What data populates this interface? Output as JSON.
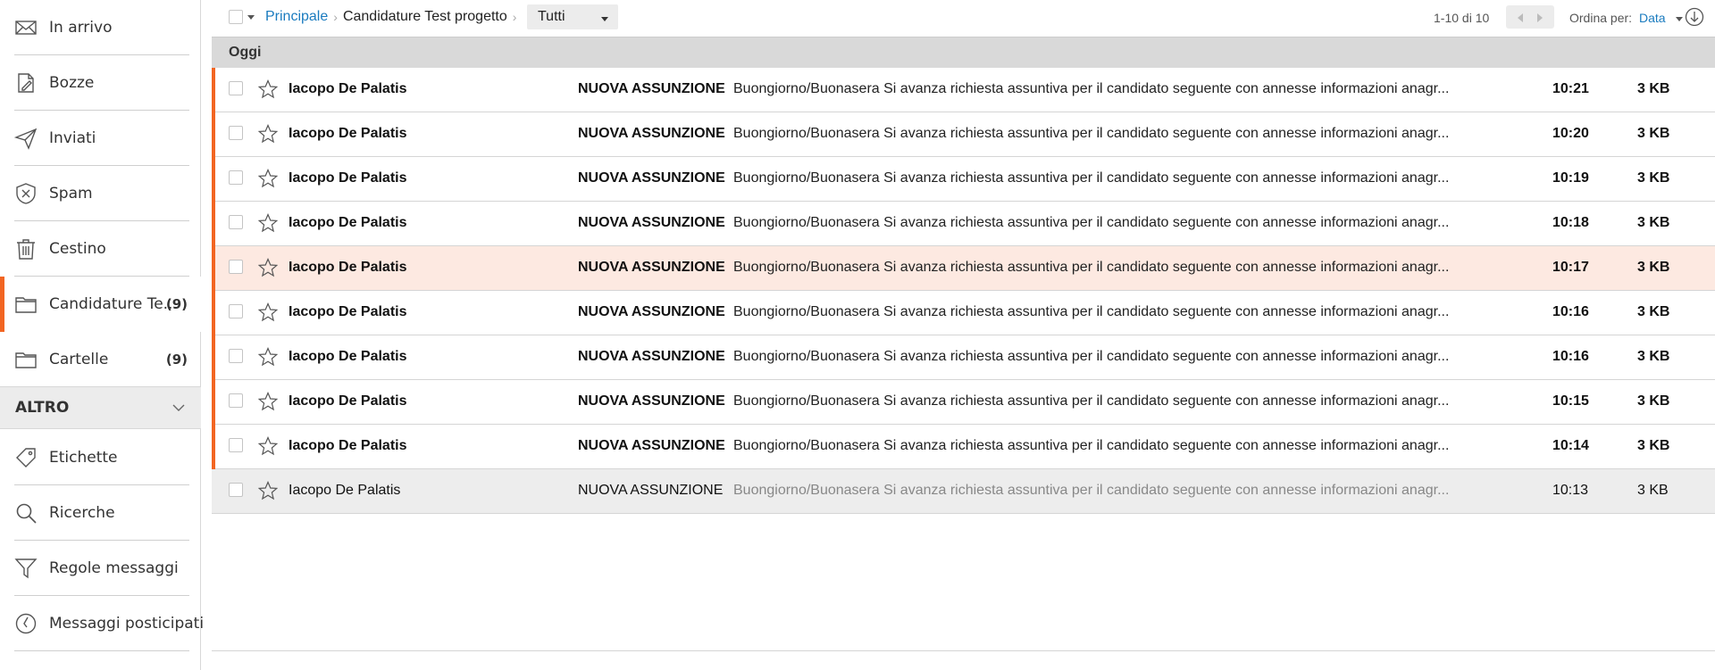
{
  "sidebar": {
    "items": [
      {
        "label": "In arrivo",
        "icon": "envelope-icon"
      },
      {
        "label": "Bozze",
        "icon": "draft-icon"
      },
      {
        "label": "Inviati",
        "icon": "send-icon"
      },
      {
        "label": "Spam",
        "icon": "shield-icon"
      },
      {
        "label": "Cestino",
        "icon": "trash-icon"
      },
      {
        "label": "Candidature Te...",
        "icon": "folder-icon",
        "count": "(9)"
      },
      {
        "label": "Cartelle",
        "icon": "folder-icon",
        "count": "(9)"
      }
    ],
    "section_label": "ALTRO",
    "extra_items": [
      {
        "label": "Etichette",
        "icon": "tag-icon"
      },
      {
        "label": "Ricerche",
        "icon": "search-icon"
      },
      {
        "label": "Regole messaggi",
        "icon": "filter-icon"
      },
      {
        "label": "Messaggi posticipati",
        "icon": "clock-icon"
      }
    ],
    "accent_color": "#f26522"
  },
  "toolbar": {
    "breadcrumb_home": "Principale",
    "breadcrumb_current": "Candidature Test progetto",
    "filter_value": "Tutti",
    "pager_text": "1-10 di 10",
    "sort_label": "Ordina per:",
    "sort_value": "Data"
  },
  "group": {
    "label": "Oggi"
  },
  "messages": [
    {
      "sender": "Iacopo De Palatis",
      "subject": "NUOVA ASSUNZIONE",
      "preview": "Buongiorno/Buonasera Si avanza richiesta assuntiva per il candidato seguente con annesse informazioni anagr...",
      "time": "10:21",
      "size": "3 KB",
      "state": "unread"
    },
    {
      "sender": "Iacopo De Palatis",
      "subject": "NUOVA ASSUNZIONE",
      "preview": "Buongiorno/Buonasera Si avanza richiesta assuntiva per il candidato seguente con annesse informazioni anagr...",
      "time": "10:20",
      "size": "3 KB",
      "state": "unread"
    },
    {
      "sender": "Iacopo De Palatis",
      "subject": "NUOVA ASSUNZIONE",
      "preview": "Buongiorno/Buonasera Si avanza richiesta assuntiva per il candidato seguente con annesse informazioni anagr...",
      "time": "10:19",
      "size": "3 KB",
      "state": "unread"
    },
    {
      "sender": "Iacopo De Palatis",
      "subject": "NUOVA ASSUNZIONE",
      "preview": "Buongiorno/Buonasera Si avanza richiesta assuntiva per il candidato seguente con annesse informazioni anagr...",
      "time": "10:18",
      "size": "3 KB",
      "state": "unread"
    },
    {
      "sender": "Iacopo De Palatis",
      "subject": "NUOVA ASSUNZIONE",
      "preview": "Buongiorno/Buonasera Si avanza richiesta assuntiva per il candidato seguente con annesse informazioni anagr...",
      "time": "10:17",
      "size": "3 KB",
      "state": "unread-highlight"
    },
    {
      "sender": "Iacopo De Palatis",
      "subject": "NUOVA ASSUNZIONE",
      "preview": "Buongiorno/Buonasera Si avanza richiesta assuntiva per il candidato seguente con annesse informazioni anagr...",
      "time": "10:16",
      "size": "3 KB",
      "state": "unread"
    },
    {
      "sender": "Iacopo De Palatis",
      "subject": "NUOVA ASSUNZIONE",
      "preview": "Buongiorno/Buonasera Si avanza richiesta assuntiva per il candidato seguente con annesse informazioni anagr...",
      "time": "10:16",
      "size": "3 KB",
      "state": "unread"
    },
    {
      "sender": "Iacopo De Palatis",
      "subject": "NUOVA ASSUNZIONE",
      "preview": "Buongiorno/Buonasera Si avanza richiesta assuntiva per il candidato seguente con annesse informazioni anagr...",
      "time": "10:15",
      "size": "3 KB",
      "state": "unread"
    },
    {
      "sender": "Iacopo De Palatis",
      "subject": "NUOVA ASSUNZIONE",
      "preview": "Buongiorno/Buonasera Si avanza richiesta assuntiva per il candidato seguente con annesse informazioni anagr...",
      "time": "10:14",
      "size": "3 KB",
      "state": "unread"
    },
    {
      "sender": "Iacopo De Palatis",
      "subject": "NUOVA ASSUNZIONE",
      "preview": "Buongiorno/Buonasera Si avanza richiesta assuntiva per il candidato seguente con annesse informazioni anagr...",
      "time": "10:13",
      "size": "3 KB",
      "state": "read"
    }
  ]
}
